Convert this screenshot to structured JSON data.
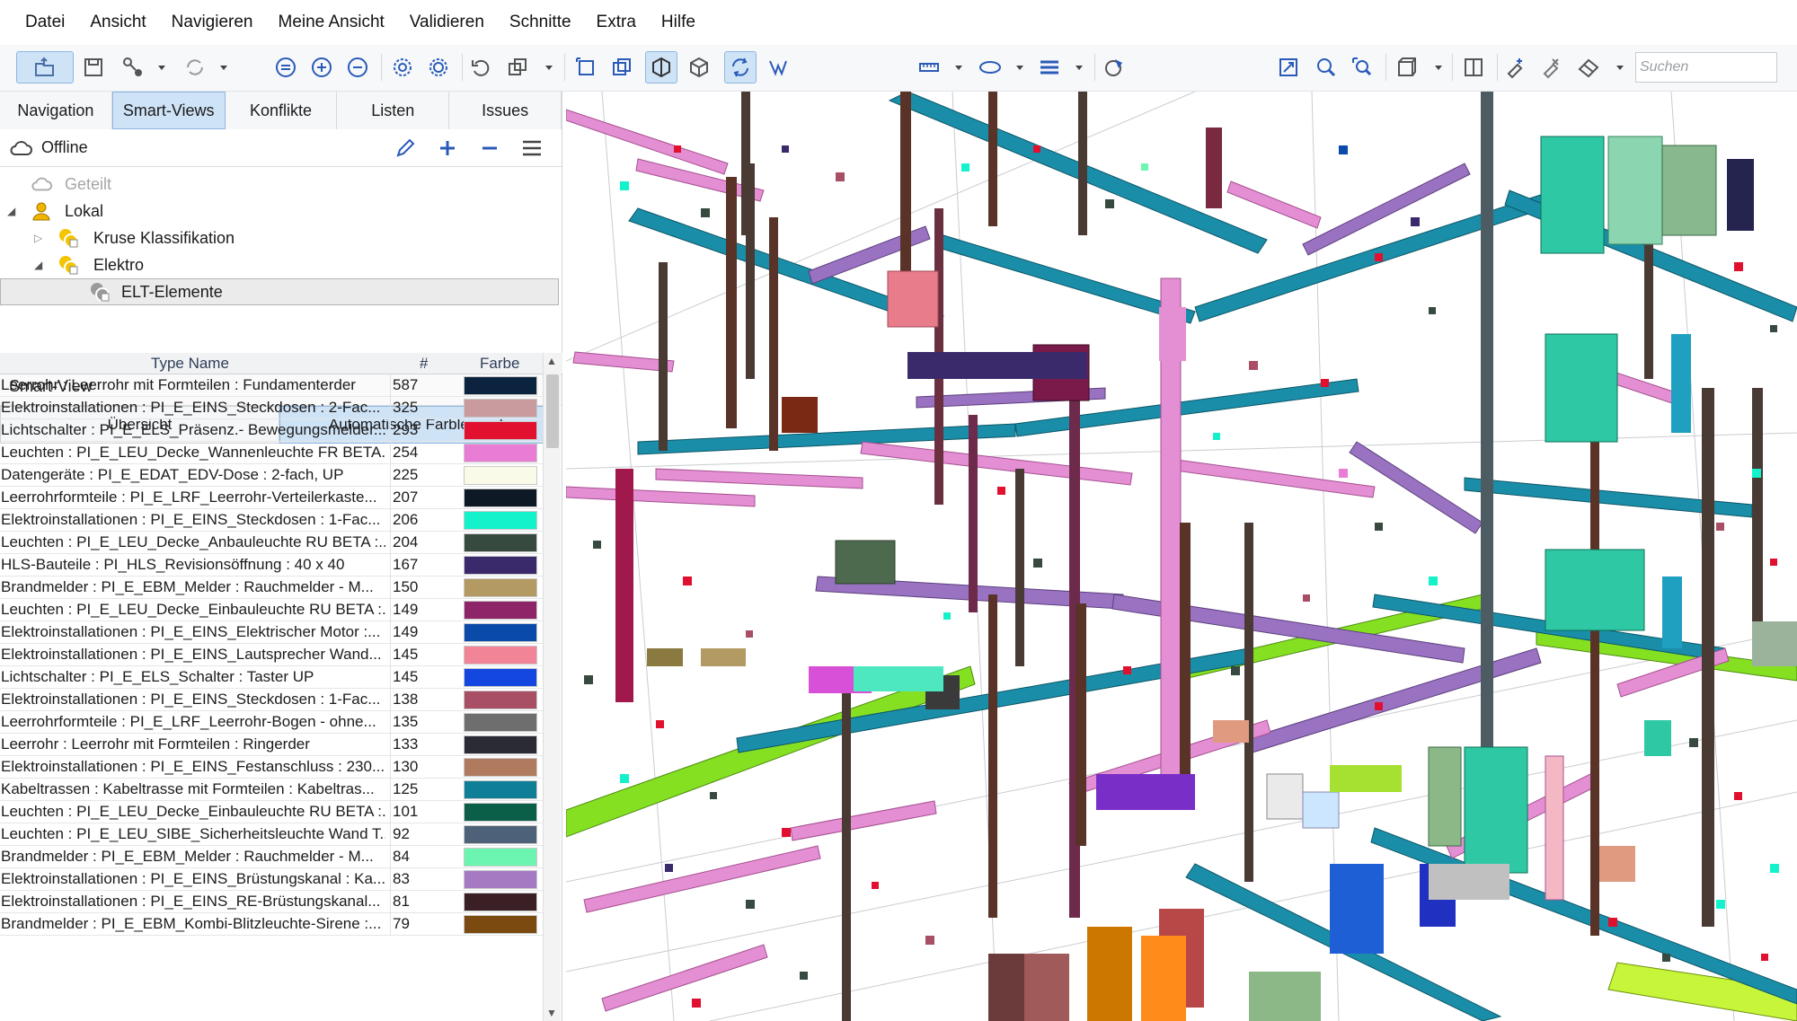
{
  "menu": [
    "Datei",
    "Ansicht",
    "Navigieren",
    "Meine Ansicht",
    "Validieren",
    "Schnitte",
    "Extra",
    "Hilfe"
  ],
  "search": {
    "placeholder": "Suchen"
  },
  "tabs": [
    "Navigation",
    "Smart-Views",
    "Konflikte",
    "Listen",
    "Issues"
  ],
  "active_tab": "Smart-Views",
  "offline": {
    "label": "Offline"
  },
  "tree": {
    "shared": "Geteilt",
    "local": "Lokal",
    "kruse": "Kruse Klassifikation",
    "elektro": "Elektro",
    "elt": "ELT-Elemente"
  },
  "smartview": {
    "title": "Smart-View",
    "tab_overview": "Übersicht",
    "tab_legend": "Automatische Farblegende",
    "col_type": "Type Name",
    "col_count": "#",
    "col_color": "Farbe"
  },
  "rows": [
    {
      "name": "Leerrohr : Leerrohr mit Formteilen : Fundamenterder",
      "count": "587",
      "color": "#0c2340"
    },
    {
      "name": "Elektroinstallationen : PI_E_EINS_Steckdosen : 2-Fac...",
      "count": "325",
      "color": "#c99a9e"
    },
    {
      "name": "Lichtschalter : PI_E_ELS_Präsenz.- Bewegungsmelder...",
      "count": "293",
      "color": "#e0102e"
    },
    {
      "name": "Leuchten : PI_E_LEU_Decke_Wannenleuchte FR BETA...",
      "count": "254",
      "color": "#e97dd6"
    },
    {
      "name": "Datengeräte : PI_E_EDAT_EDV-Dose : 2-fach, UP",
      "count": "225",
      "color": "#fafae8"
    },
    {
      "name": "Leerrohrformteile : PI_E_LRF_Leerrohr-Verteilerkaste...",
      "count": "207",
      "color": "#0d1a26"
    },
    {
      "name": "Elektroinstallationen : PI_E_EINS_Steckdosen : 1-Fac...",
      "count": "206",
      "color": "#14f2cc"
    },
    {
      "name": "Leuchten : PI_E_LEU_Decke_Anbauleuchte RU BETA :...",
      "count": "204",
      "color": "#364a3f"
    },
    {
      "name": "HLS-Bauteile : PI_HLS_Revisionsöffnung : 40 x 40",
      "count": "167",
      "color": "#3b2a6b"
    },
    {
      "name": "Brandmelder : PI_E_EBM_Melder : Rauchmelder - M...",
      "count": "150",
      "color": "#b39a63"
    },
    {
      "name": "Leuchten : PI_E_LEU_Decke_Einbauleuchte RU BETA :...",
      "count": "149",
      "color": "#8e2569"
    },
    {
      "name": "Elektroinstallationen : PI_E_EINS_Elektrischer Motor :...",
      "count": "149",
      "color": "#0a4aa8"
    },
    {
      "name": "Elektroinstallationen : PI_E_EINS_Lautsprecher Wand...",
      "count": "145",
      "color": "#f28498"
    },
    {
      "name": "Lichtschalter : PI_E_ELS_Schalter : Taster UP",
      "count": "145",
      "color": "#1446e0"
    },
    {
      "name": "Elektroinstallationen : PI_E_EINS_Steckdosen : 1-Fac...",
      "count": "138",
      "color": "#a84f66"
    },
    {
      "name": "Leerrohrformteile : PI_E_LRF_Leerrohr-Bogen - ohne...",
      "count": "135",
      "color": "#6e6e6e"
    },
    {
      "name": "Leerrohr : Leerrohr mit Formteilen : Ringerder",
      "count": "133",
      "color": "#2b2b35"
    },
    {
      "name": "Elektroinstallationen : PI_E_EINS_Festanschluss : 230...",
      "count": "130",
      "color": "#b07a5e"
    },
    {
      "name": "Kabeltrassen : Kabeltrasse mit Formteilen : Kabeltras...",
      "count": "125",
      "color": "#0f7f98"
    },
    {
      "name": "Leuchten : PI_E_LEU_Decke_Einbauleuchte RU BETA :...",
      "count": "101",
      "color": "#0b5e47"
    },
    {
      "name": "Leuchten : PI_E_LEU_SIBE_Sicherheitsleuchte Wand T...",
      "count": "92",
      "color": "#4d6178"
    },
    {
      "name": "Brandmelder : PI_E_EBM_Melder : Rauchmelder - M...",
      "count": "84",
      "color": "#6bf5b0"
    },
    {
      "name": "Elektroinstallationen : PI_E_EINS_Brüstungskanal : Ka...",
      "count": "83",
      "color": "#a57ac2"
    },
    {
      "name": "Elektroinstallationen : PI_E_EINS_RE-Brüstungskanal...",
      "count": "81",
      "color": "#3a1f24"
    },
    {
      "name": "Brandmelder : PI_E_EBM_Kombi-Blitzleuchte-Sirene :...",
      "count": "79",
      "color": "#7a4a10"
    }
  ],
  "icons": {
    "toolbar": [
      "open-file-icon",
      "save-icon",
      "connect-icon",
      "sync-icon",
      "select-all-icon",
      "add-to-selection-icon",
      "remove-from-selection-icon",
      "isolate-icon",
      "hide-icon",
      "undo-icon",
      "copy-icon",
      "box-select-icon",
      "clip-icon",
      "section-box-icon",
      "cube-icon",
      "orbit-icon",
      "walk-icon",
      "measure-icon",
      "ellipse-icon",
      "layers-icon",
      "materials-icon",
      "fit-icon",
      "zoom-icon",
      "zoom-window-icon",
      "view-cube-icon",
      "split-view-icon",
      "add-marker-icon",
      "remove-marker-icon",
      "eraser-icon"
    ]
  },
  "colors": {
    "accent": "#2a5bb8",
    "active_tab_bg": "#cfe3f7",
    "tray_green": "#86e022",
    "tray_cyan": "#1a8ea8",
    "tray_pink": "#e48fd3",
    "pipe_purple": "#9a72c2",
    "cabinet_teal": "#2ec9a4"
  }
}
